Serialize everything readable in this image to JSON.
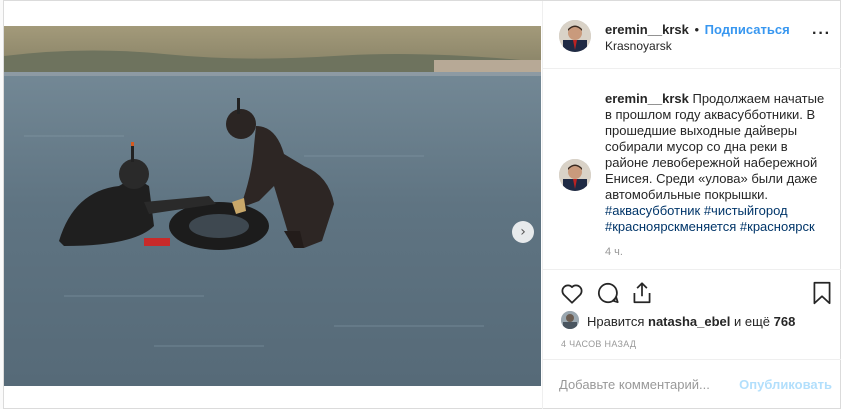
{
  "post": {
    "username": "eremin__krsk",
    "separator": "•",
    "follow_label": "Подписаться",
    "location": "Krasnoyarsk",
    "more_label": "···",
    "caption_user": "eremin__krsk",
    "caption_text": "Продолжаем начатые в прошлом году аквасубботники. В прошедшие выходные дайверы собирали мусор со дна реки в районе левобережной набережной Енисея. Среди «улова» были даже автомобильные покрышки.",
    "hashtags": [
      "#аквасубботник",
      "#чистыйгород",
      "#красноярскменяется",
      "#красноярск"
    ],
    "caption_time": "4 ч.",
    "likes_prefix": "Нравится",
    "likes_user": "natasha_ebel",
    "likes_middle": "и ещё",
    "likes_count": "768",
    "posted_ago": "4 ЧАСОВ НАЗАД",
    "comment_placeholder": "Добавьте комментарий...",
    "publish_label": "Опубликовать"
  },
  "carousel": {
    "next_label": "›",
    "slides": 3,
    "active_slide": 1
  },
  "icons": {
    "like": "heart-icon",
    "comment": "comment-icon",
    "share": "share-icon",
    "save": "bookmark-icon",
    "next": "chevron-right-icon"
  },
  "colors": {
    "link": "#3897f0",
    "hashtag": "#003569",
    "muted": "#999999",
    "publish_disabled": "#b2dffc",
    "border": "#dbdbdb"
  }
}
